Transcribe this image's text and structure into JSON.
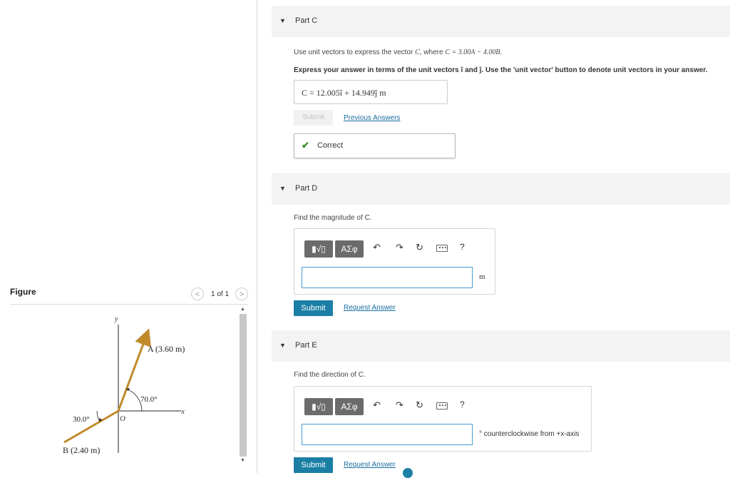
{
  "figure": {
    "title": "Figure",
    "pager": {
      "text": "1 of 1",
      "prev": "<",
      "next": ">"
    },
    "axis_y": "y",
    "axis_x": "x",
    "origin": "O",
    "vector_a_label": "A (3.60 m)",
    "vector_b_label": "B (2.40 m)",
    "angle_a": "70.0°",
    "angle_b": "30.0°"
  },
  "part_c": {
    "title": "Part C",
    "prompt_prefix": "Use unit vectors to express the vector ",
    "prompt_vec": "C",
    "prompt_mid": ", where ",
    "prompt_eq": "C = 3.00A − 4.00B",
    "prompt_end": ".",
    "instruction": "Express your answer in terms of the unit vectors î and ĵ. Use the 'unit vector' button to denote unit vectors in your answer.",
    "answer": "C = 12.005î + 14.949ĵ  m",
    "submit_label": "Submit",
    "previous_answers_label": "Previous Answers",
    "correct_label": "Correct"
  },
  "part_d": {
    "title": "Part D",
    "prompt": "Find the magnitude of C.",
    "templates_label": "▮√▯",
    "symbols_label": "ΑΣφ",
    "help_label": "?",
    "unit": "m",
    "submit_label": "Submit",
    "request_answer_label": "Request Answer",
    "input_value": ""
  },
  "part_e": {
    "title": "Part E",
    "prompt": "Find the direction of C.",
    "templates_label": "▮√▯",
    "symbols_label": "ΑΣφ",
    "help_label": "?",
    "unit": "° counterclockwise from +x-axis",
    "submit_label": "Submit",
    "request_answer_label": "Request Answer",
    "input_value": ""
  },
  "colors": {
    "primary_button": "#1b7fa5",
    "link": "#1a6ea0",
    "correct_check": "#3f8a26",
    "vector_arrow": "#c08a2c"
  }
}
